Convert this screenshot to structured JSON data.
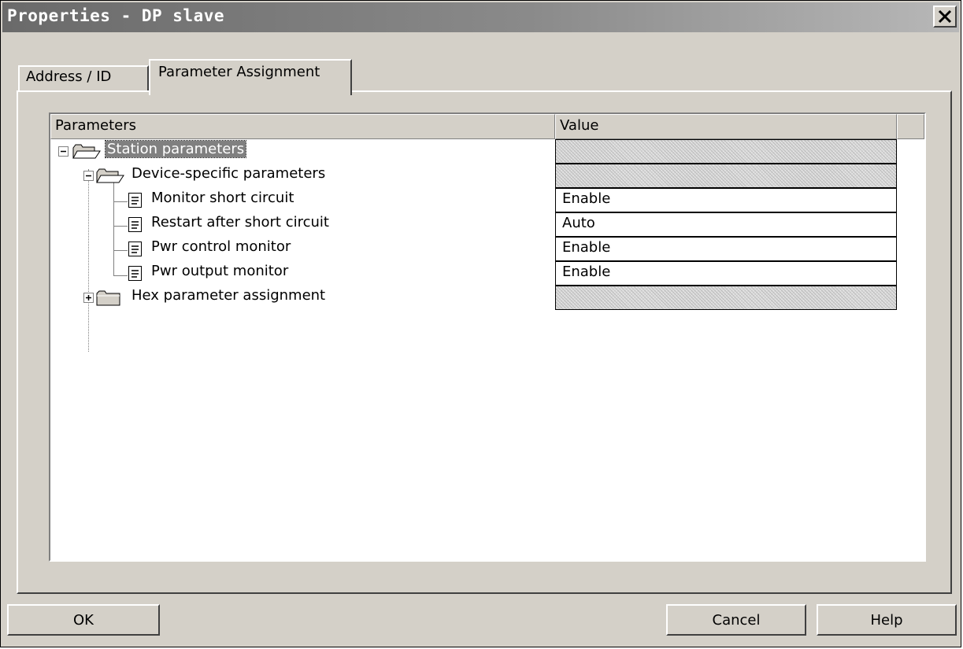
{
  "window": {
    "title": "Properties - DP slave"
  },
  "tabs": [
    {
      "label": "Address / ID",
      "active": false
    },
    {
      "label": "Parameter Assignment",
      "active": true
    }
  ],
  "table": {
    "columns": [
      "Parameters",
      "Value"
    ],
    "rows": [
      {
        "label": "Station parameters",
        "value": "",
        "icon": "open-folder-icon",
        "expander": "minus",
        "level": 0,
        "selected": true
      },
      {
        "label": "Device-specific parameters",
        "value": "",
        "icon": "open-folder-icon",
        "expander": "minus",
        "level": 1
      },
      {
        "label": "Monitor short circuit",
        "value": "Enable",
        "icon": "parameter-document-icon",
        "level": 2
      },
      {
        "label": "Restart after short circuit",
        "value": "Auto",
        "icon": "parameter-document-icon",
        "level": 2
      },
      {
        "label": "Pwr control monitor",
        "value": "Enable",
        "icon": "parameter-document-icon",
        "level": 2
      },
      {
        "label": "Pwr output monitor",
        "value": "Enable",
        "icon": "parameter-document-icon",
        "level": 2
      },
      {
        "label": "Hex parameter assignment",
        "value": "",
        "icon": "closed-folder-icon",
        "expander": "plus",
        "level": 1
      }
    ]
  },
  "buttons": {
    "ok": "OK",
    "cancel": "Cancel",
    "help": "Help"
  },
  "colors": {
    "titlebar": "#6a6a6a",
    "dialog_face": "#d4d0c8",
    "selection": "#808080"
  }
}
